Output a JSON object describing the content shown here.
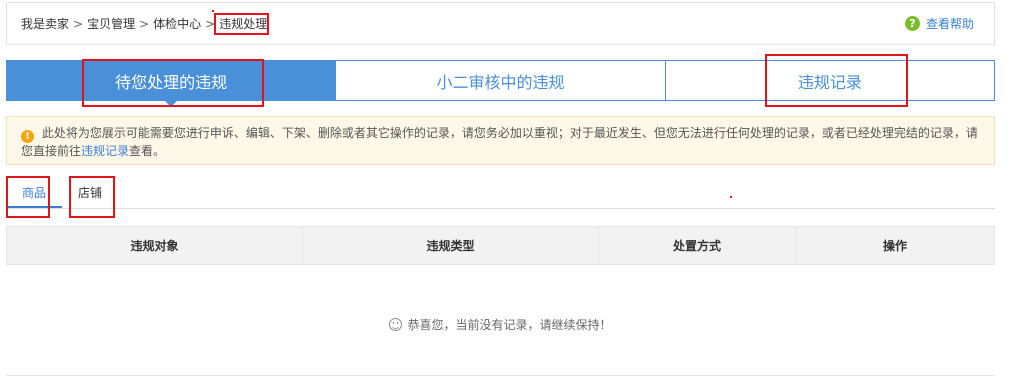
{
  "breadcrumb": {
    "items": [
      "我是卖家",
      "宝贝管理",
      "体检中心",
      "违规处理"
    ],
    "separator": ">"
  },
  "help": {
    "label": "查看帮助",
    "icon": "question-circle-icon"
  },
  "tabs": [
    {
      "label": "待您处理的违规",
      "active": true
    },
    {
      "label": "小二审核中的违规",
      "active": false
    },
    {
      "label": "违规记录",
      "active": false
    }
  ],
  "notice": {
    "icon": "warning-icon",
    "text_before": "此处将为您展示可能需要您进行申诉、编辑、下架、删除或者其它操作的记录，请您务必加以重视；对于最近发生、但您无法进行任何处理的记录，或者已经处理完结的记录，请您直接前往",
    "link": "违规记录",
    "text_after": "查看。"
  },
  "subtabs": [
    {
      "label": "商品",
      "active": true
    },
    {
      "label": "店铺",
      "active": false
    }
  ],
  "table": {
    "columns": [
      "违规对象",
      "违规类型",
      "处置方式",
      "操作"
    ]
  },
  "empty_state": {
    "icon": "smile-icon",
    "text": "恭喜您，当前没有记录，请继续保持！"
  },
  "colors": {
    "accent": "#4a90d9",
    "highlight": "#e0141c",
    "notice_bg": "#fef8e8"
  }
}
